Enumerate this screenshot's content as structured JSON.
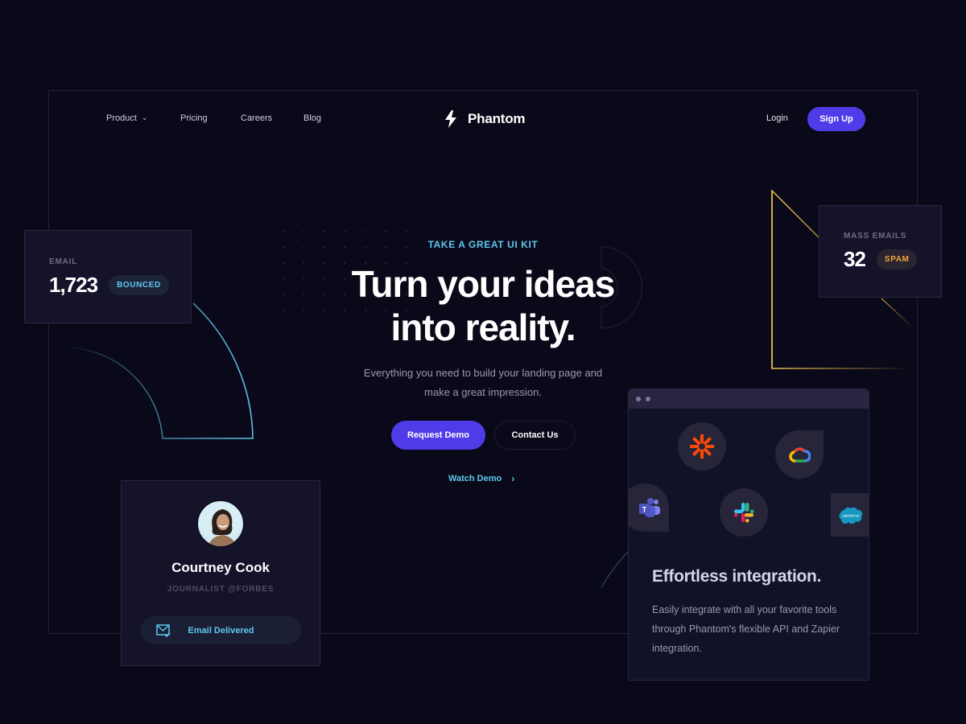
{
  "nav": {
    "items": [
      {
        "label": "Product",
        "has_dropdown": true
      },
      {
        "label": "Pricing"
      },
      {
        "label": "Careers"
      },
      {
        "label": "Blog"
      }
    ],
    "brand": "Phantom",
    "login_label": "Login",
    "signup_label": "Sign Up"
  },
  "hero": {
    "eyebrow": "TAKE A GREAT UI KIT",
    "headline_line1": "Turn your ideas",
    "headline_line2": "into reality.",
    "subtitle_line1": "Everything you need to build your landing page and",
    "subtitle_line2": "make a great impression.",
    "primary_cta": "Request Demo",
    "secondary_cta": "Contact Us",
    "watch_demo": "Watch Demo"
  },
  "email_card": {
    "label": "EMAIL",
    "value": "1,723",
    "badge": "BOUNCED"
  },
  "mass_card": {
    "label": "MASS EMAILS",
    "value": "32",
    "badge": "SPAM"
  },
  "profile_card": {
    "name": "Courtney Cook",
    "role": "JOURNALIST @FORBES",
    "status": "Email Delivered"
  },
  "integration_card": {
    "title": "Effortless integration.",
    "description": "Easily integrate with all your favorite tools through Phantom's flexible API and Zapier integration.",
    "apps": [
      "zapier",
      "google-cloud",
      "microsoft-teams",
      "slack",
      "salesforce"
    ]
  },
  "colors": {
    "background": "#0a0919",
    "accent": "#4f3ce8",
    "cyan": "#5ec9ee",
    "orange": "#f0a63b",
    "card": "#15132a"
  }
}
